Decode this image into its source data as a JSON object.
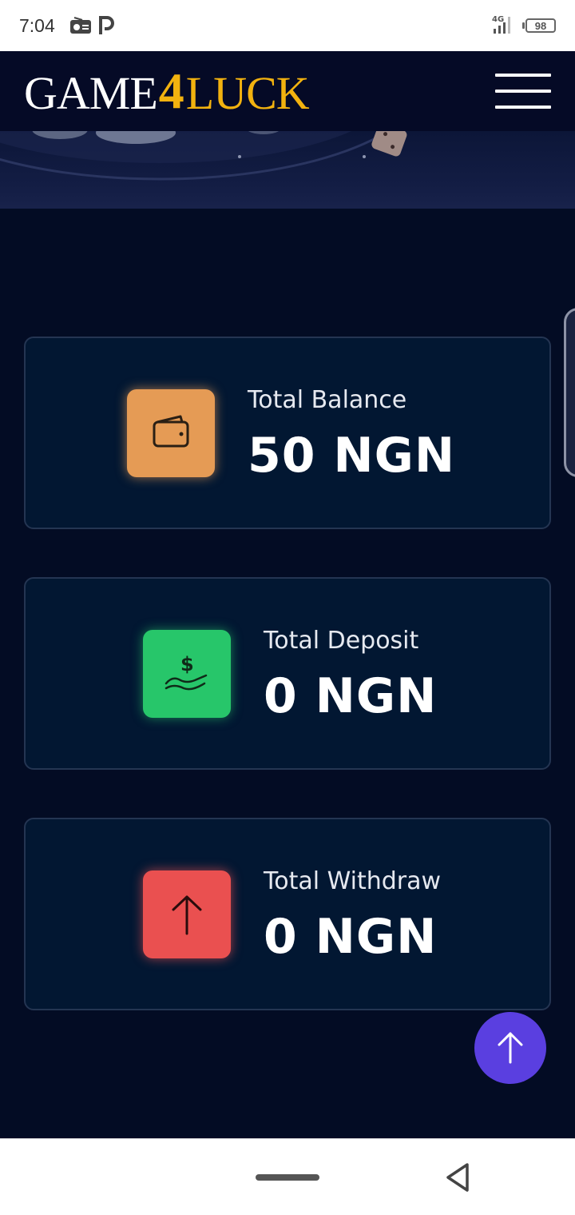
{
  "status_bar": {
    "time": "7:04",
    "network": "4G",
    "battery": "98",
    "icons": [
      "radio-icon",
      "parking-icon",
      "signal-icon",
      "battery-icon"
    ]
  },
  "header": {
    "logo": {
      "part1": "GAME",
      "part2": "4",
      "part3": "LUCK"
    },
    "menu_icon": "hamburger-menu-icon"
  },
  "cards": [
    {
      "label": "Total Balance",
      "value": "50 NGN",
      "icon": "wallet-icon",
      "color": "#e59b55"
    },
    {
      "label": "Total Deposit",
      "value": "0 NGN",
      "icon": "money-hand-icon",
      "color": "#27c66a"
    },
    {
      "label": "Total Withdraw",
      "value": "0 NGN",
      "icon": "arrow-up-icon",
      "color": "#ea5050"
    }
  ],
  "fab": {
    "icon": "arrow-up-icon",
    "color": "#5a3fe0"
  },
  "colors": {
    "background": "#030c24",
    "card": "#021732",
    "logo_accent": "#f2b20f"
  }
}
